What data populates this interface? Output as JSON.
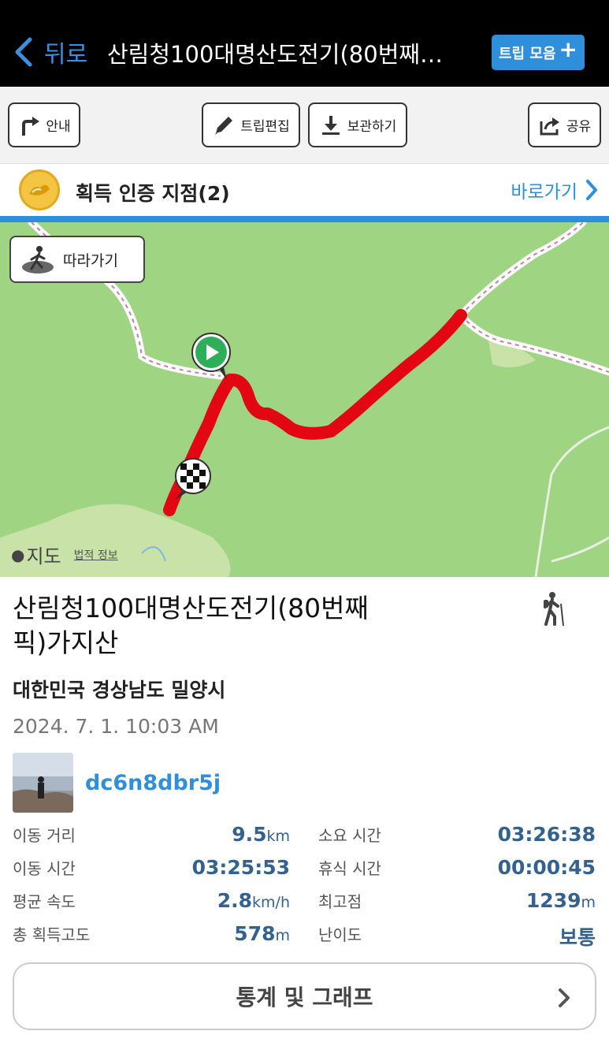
{
  "nav": {
    "back_label": "뒤로",
    "title": "산림청100대명산도전기(80번째…",
    "trip_collection_label": "트립 모음"
  },
  "toolbar": {
    "guide_label": "안내",
    "edit_label": "트립편집",
    "save_label": "보관하기",
    "share_label": "공유"
  },
  "badges": {
    "text": "획득 인증 지점(2)",
    "goto_label": "바로가기"
  },
  "map": {
    "follow_label": "따라가기",
    "maps_brand": "지도",
    "legal_label": "법적 정보",
    "route_color": "#e30613"
  },
  "trip": {
    "name": "산림청100대명산도전기(80번째픽)가지산",
    "location": "대한민국 경상남도 밀양시",
    "datetime": "2024. 7. 1. 10:03 AM",
    "username": "dc6n8dbr5j",
    "activity_icon": "hiking-icon"
  },
  "stats": [
    {
      "label": "이동 거리",
      "value": "9.5",
      "unit": "km"
    },
    {
      "label": "소요 시간",
      "value": "03:26:38",
      "unit": ""
    },
    {
      "label": "이동 시간",
      "value": "03:25:53",
      "unit": ""
    },
    {
      "label": "휴식 시간",
      "value": "00:00:45",
      "unit": ""
    },
    {
      "label": "평균 속도",
      "value": "2.8",
      "unit": "km/h"
    },
    {
      "label": "최고점",
      "value": "1239",
      "unit": "m"
    },
    {
      "label": "총 획득고도",
      "value": "578",
      "unit": "m"
    },
    {
      "label": "난이도",
      "value": "보통",
      "unit": ""
    }
  ],
  "stats_button_label": "통계 및 그래프",
  "colors": {
    "accent": "#2f8fdb",
    "nav_bg": "#000000",
    "map_green": "#9fd483",
    "stat_value": "#34628f"
  }
}
